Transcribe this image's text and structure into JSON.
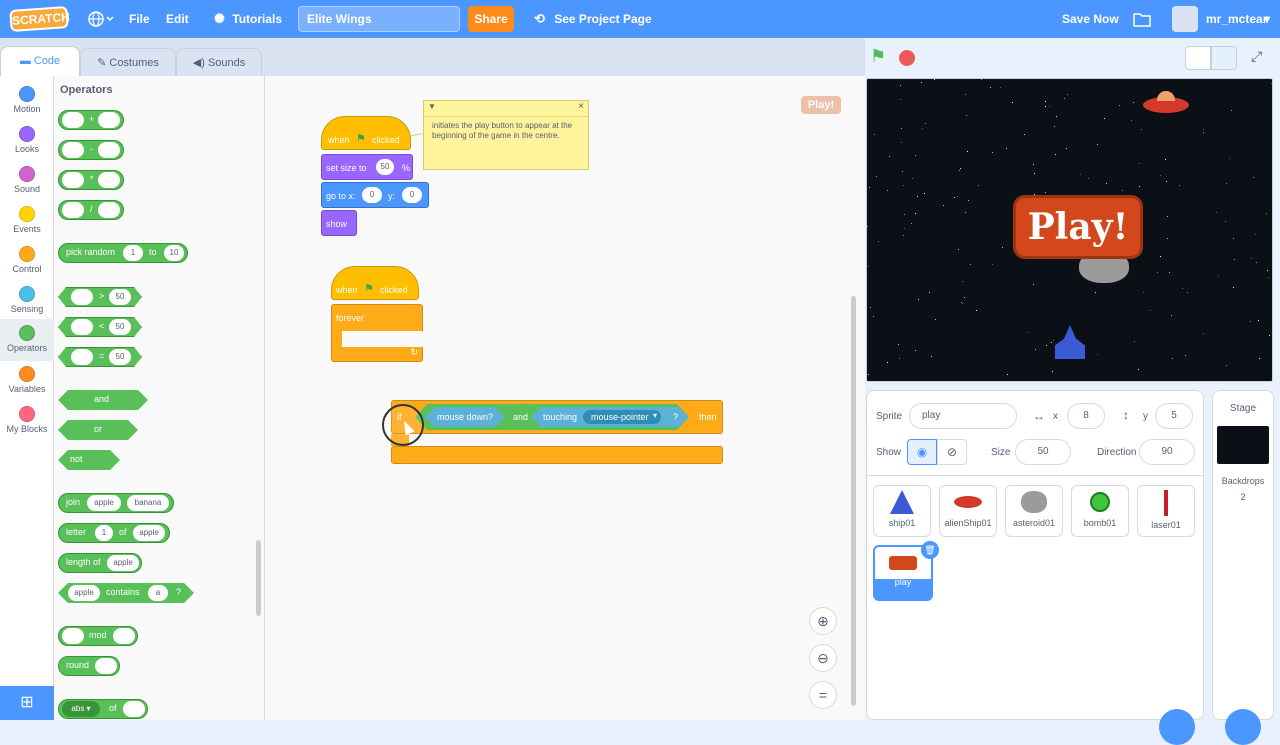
{
  "menubar": {
    "logo": "SCRATCH",
    "file": "File",
    "edit": "Edit",
    "tutorials": "Tutorials",
    "project_title": "Elite Wings",
    "share": "Share",
    "see_project": "See Project Page",
    "save_now": "Save Now",
    "username": "mr_mctear"
  },
  "tabs": {
    "code": "Code",
    "costumes": "Costumes",
    "sounds": "Sounds"
  },
  "categories": [
    {
      "label": "Motion",
      "color": "#4c97ff"
    },
    {
      "label": "Looks",
      "color": "#9966ff"
    },
    {
      "label": "Sound",
      "color": "#cf63cf"
    },
    {
      "label": "Events",
      "color": "#ffd500"
    },
    {
      "label": "Control",
      "color": "#ffab19"
    },
    {
      "label": "Sensing",
      "color": "#4cbfe6"
    },
    {
      "label": "Operators",
      "color": "#59c059"
    },
    {
      "label": "Variables",
      "color": "#ff8c1a"
    },
    {
      "label": "My Blocks",
      "color": "#ff6680"
    }
  ],
  "flyout": {
    "heading": "Operators",
    "plus": "+",
    "minus": "-",
    "times": "*",
    "divide": "/",
    "pick_random": "pick random",
    "pick_from": "1",
    "pick_to_label": "to",
    "pick_to": "10",
    "gt": ">",
    "lt": "<",
    "eq": "=",
    "cmp_value": "50",
    "and": "and",
    "or": "or",
    "not": "not",
    "join": "join",
    "join_a": "apple",
    "join_b": "banana",
    "letter": "letter",
    "letter_n": "1",
    "letter_of": "of",
    "letter_word": "apple",
    "length_of": "length of",
    "length_word": "apple",
    "contains_a": "apple",
    "contains": "contains",
    "contains_b": "a",
    "contains_q": "?",
    "mod": "mod",
    "round": "round",
    "abs": "abs",
    "abs_of": "of"
  },
  "script1": {
    "when": "when",
    "clicked": "clicked",
    "set_size": "set size to",
    "size_val": "50",
    "percent": "%",
    "goto_x": "go to x:",
    "x_val": "0",
    "y_label": "y:",
    "y_val": "0",
    "show": "show"
  },
  "comment": "initiates the play button to appear at the beginning of the game in the centre.",
  "script2": {
    "when": "when",
    "clicked": "clicked",
    "forever": "forever"
  },
  "script3": {
    "if": "if",
    "mouse_down": "mouse down?",
    "and": "and",
    "touching": "touching",
    "mouse_pointer": "mouse-pointer",
    "q": "?",
    "then": "then"
  },
  "play_sprite_small": "Play!",
  "stage_play": "Play!",
  "sprite_info": {
    "sprite_label": "Sprite",
    "sprite_name": "play",
    "x_label": "x",
    "x_val": "8",
    "y_label": "y",
    "y_val": "5",
    "show_label": "Show",
    "size_label": "Size",
    "size_val": "50",
    "direction_label": "Direction",
    "direction_val": "90"
  },
  "sprites": [
    "ship01",
    "alienShip01",
    "asteroid01",
    "bomb01",
    "laser01",
    "play"
  ],
  "stage_panel": {
    "title": "Stage",
    "backdrops_label": "Backdrops",
    "backdrops_count": "2"
  }
}
